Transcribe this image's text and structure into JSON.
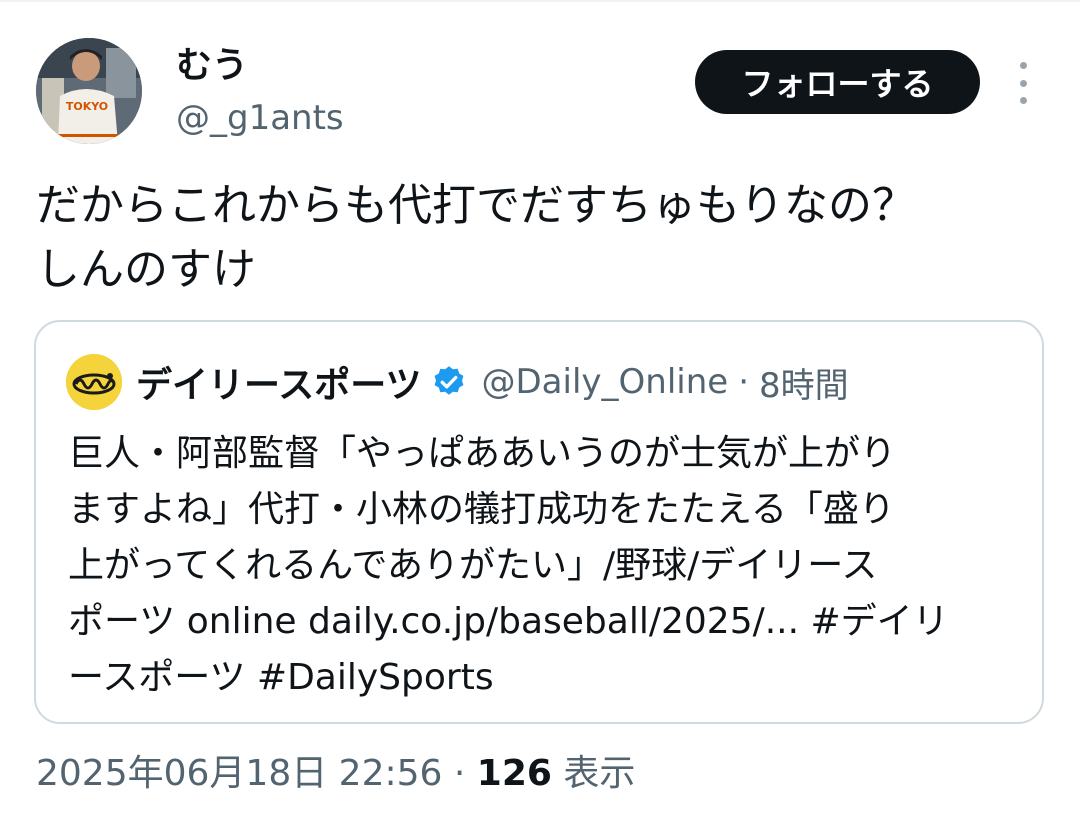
{
  "author": {
    "display_name": "むう",
    "handle": "@_g1ants",
    "avatar_icon": "baseball-player-photo-avatar",
    "avatar_jersey_text": "TOKYO"
  },
  "follow_button": {
    "label": "フォローする"
  },
  "more_icon": "more-vertical-icon",
  "tweet": {
    "lines": [
      "だからこれからも代打でだすちゅもりなの？",
      "しんのすけ"
    ]
  },
  "quote": {
    "avatar_icon": "daily-sports-logo-avatar",
    "name": "デイリースポーツ",
    "verified_icon": "verified-badge-icon",
    "handle": "@Daily_Online",
    "separator": "·",
    "time": "8時間",
    "body_lines": [
      "巨人・阿部監督「やっぱああいうのが士気が上がり",
      "ますよね」代打・小林の犠打成功をたたえる「盛り",
      "上がってくれるんでありがたい」/野球/デイリース",
      "ポーツ online daily.co.jp/baseball/2025/... #デイリ",
      "ースポーツ #DailySports"
    ]
  },
  "meta": {
    "timestamp": "2025年06月18日 22:56",
    "separator": "·",
    "views_count": "126",
    "views_label": "表示"
  },
  "colors": {
    "text_primary": "#0f1419",
    "text_secondary": "#536471",
    "follow_bg": "#0f1419",
    "border": "#cfd9de",
    "verified": "#1d9bf0",
    "quote_avatar_bg": "#f5d33a"
  }
}
